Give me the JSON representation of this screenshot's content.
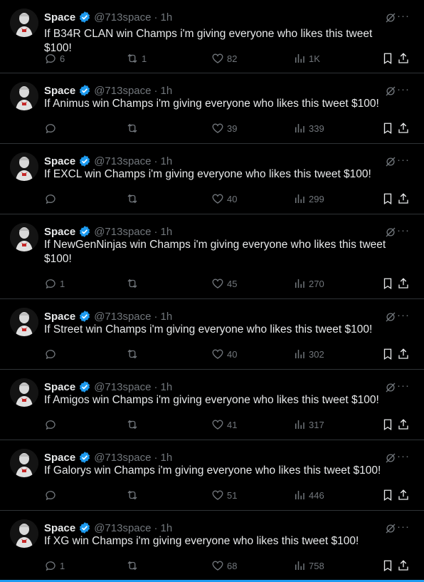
{
  "colors": {
    "background": "#000000",
    "text": "#e7e9ea",
    "muted": "#71767b",
    "accent": "#1d9bf0",
    "divider": "#2f3336"
  },
  "tweets": [
    {
      "name": "Space",
      "handle": "@713space",
      "time": "1h",
      "text": "If B34R CLAN win Champs i'm giving everyone who likes this tweet $100!",
      "replies": "6",
      "retweets": "1",
      "likes": "82",
      "views": "1K"
    },
    {
      "name": "Space",
      "handle": "@713space",
      "time": "1h",
      "text": "If Animus win Champs i'm giving everyone who likes this tweet $100!",
      "replies": "",
      "retweets": "",
      "likes": "39",
      "views": "339"
    },
    {
      "name": "Space",
      "handle": "@713space",
      "time": "1h",
      "text": "If EXCL win Champs i'm giving everyone who likes this tweet $100!",
      "replies": "",
      "retweets": "",
      "likes": "40",
      "views": "299"
    },
    {
      "name": "Space",
      "handle": "@713space",
      "time": "1h",
      "text": "If NewGenNinjas win Champs i'm giving everyone who likes this tweet $100!",
      "replies": "1",
      "retweets": "",
      "likes": "45",
      "views": "270"
    },
    {
      "name": "Space",
      "handle": "@713space",
      "time": "1h",
      "text": "If Street win Champs i'm giving everyone who likes this tweet $100!",
      "replies": "",
      "retweets": "",
      "likes": "40",
      "views": "302"
    },
    {
      "name": "Space",
      "handle": "@713space",
      "time": "1h",
      "text": "If Amigos win Champs i'm giving everyone who likes this tweet $100!",
      "replies": "",
      "retweets": "",
      "likes": "41",
      "views": "317"
    },
    {
      "name": "Space",
      "handle": "@713space",
      "time": "1h",
      "text": "If Galorys win Champs i'm giving everyone who likes this tweet $100!",
      "replies": "",
      "retweets": "",
      "likes": "51",
      "views": "446"
    },
    {
      "name": "Space",
      "handle": "@713space",
      "time": "1h",
      "text": "If XG win Champs i'm giving everyone who likes this tweet $100!",
      "replies": "1",
      "retweets": "",
      "likes": "68",
      "views": "758"
    }
  ]
}
